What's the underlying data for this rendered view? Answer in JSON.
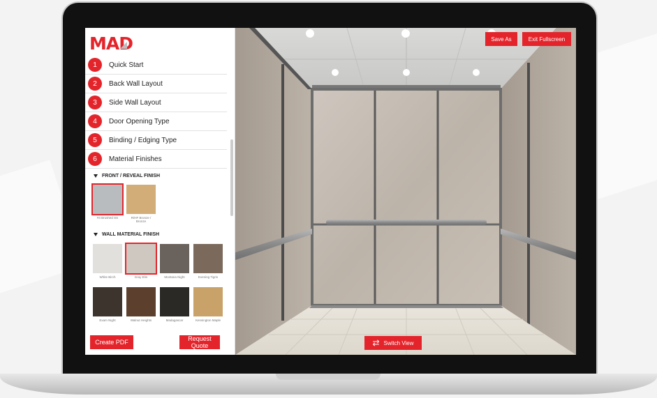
{
  "app": {
    "logo_text": "MAD"
  },
  "steps": [
    {
      "num": "1",
      "label": "Quick Start"
    },
    {
      "num": "2",
      "label": "Back Wall Layout"
    },
    {
      "num": "3",
      "label": "Side Wall Layout"
    },
    {
      "num": "4",
      "label": "Door Opening Type"
    },
    {
      "num": "5",
      "label": "Binding / Edging Type"
    },
    {
      "num": "6",
      "label": "Material Finishes"
    }
  ],
  "front_reveal": {
    "title": "FRONT / REVEAL FINISH",
    "swatches": [
      {
        "name": "#4 Brushed SS",
        "selected": true,
        "color": "#b9bcbe"
      },
      {
        "name": "R/HF Bronze / Bronze",
        "selected": false,
        "color": "#d2ad78"
      }
    ]
  },
  "wall_finish": {
    "title": "WALL MATERIAL FINISH",
    "swatches": [
      {
        "name": "White Birch",
        "selected": false,
        "color": "#e2e0dc"
      },
      {
        "name": "Gray Elm",
        "selected": true,
        "color": "#cfc8c1"
      },
      {
        "name": "Montana Night",
        "selected": false,
        "color": "#6a625c"
      },
      {
        "name": "Evening Tigris",
        "selected": false,
        "color": "#7b6a5c"
      },
      {
        "name": "Exam Night",
        "selected": false,
        "color": "#3d342e"
      },
      {
        "name": "Walnut Heights",
        "selected": false,
        "color": "#5c3f2c"
      },
      {
        "name": "Madagascar",
        "selected": false,
        "color": "#2b2925"
      },
      {
        "name": "Kensington Maple",
        "selected": false,
        "color": "#c9a26a"
      }
    ]
  },
  "actions": {
    "create_pdf": "Create PDF",
    "request_quote": "Request Quote"
  },
  "viewer": {
    "save_as": "Save As",
    "exit_fullscreen": "Exit Fullscreen",
    "switch_view": "Switch View"
  },
  "colors": {
    "accent": "#e4242b"
  }
}
